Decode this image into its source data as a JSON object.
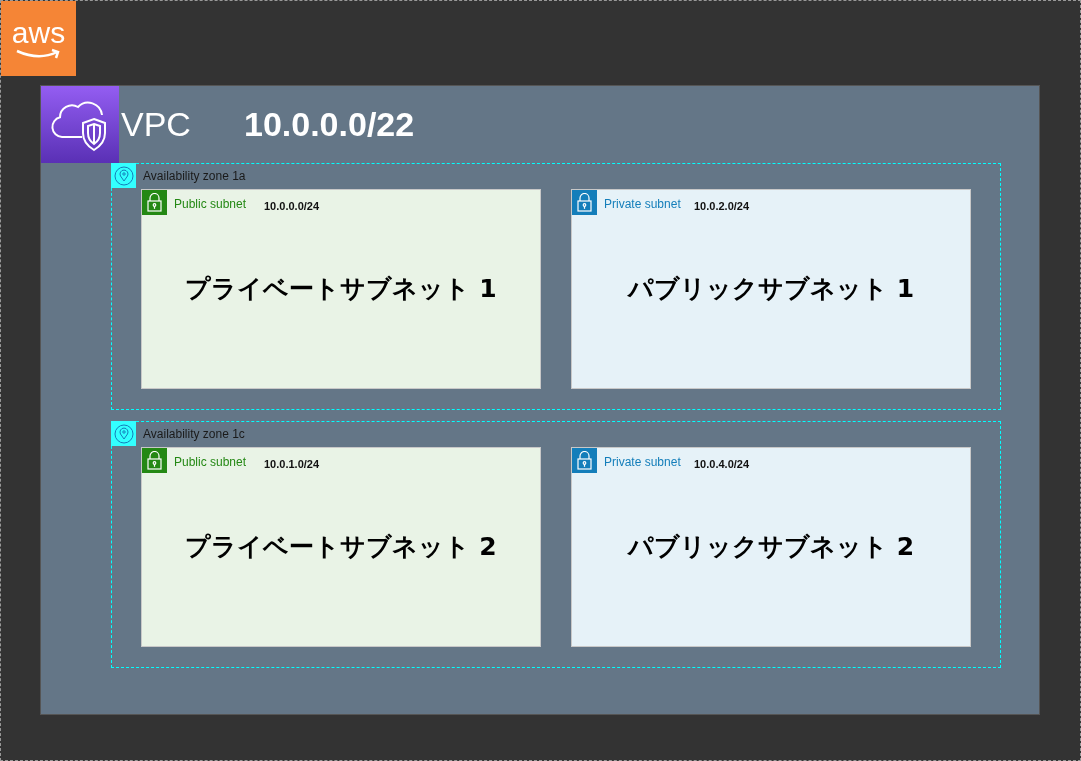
{
  "logo": {
    "text": "aws"
  },
  "vpc": {
    "label": "VPC",
    "cidr": "10.0.0.0/22",
    "zones": [
      {
        "label": "Availability zone 1a",
        "subnets": [
          {
            "kind": "public",
            "label": "Public subnet",
            "cidr": "10.0.0.0/24",
            "name": "プライベートサブネット 1"
          },
          {
            "kind": "private",
            "label": "Private subnet",
            "cidr": "10.0.2.0/24",
            "name": "パブリックサブネット 1"
          }
        ]
      },
      {
        "label": "Availability zone 1c",
        "subnets": [
          {
            "kind": "public",
            "label": "Public subnet",
            "cidr": "10.0.1.0/24",
            "name": "プライベートサブネット 2"
          },
          {
            "kind": "private",
            "label": "Private subnet",
            "cidr": "10.0.4.0/24",
            "name": "パブリックサブネット 2"
          }
        ]
      }
    ]
  }
}
